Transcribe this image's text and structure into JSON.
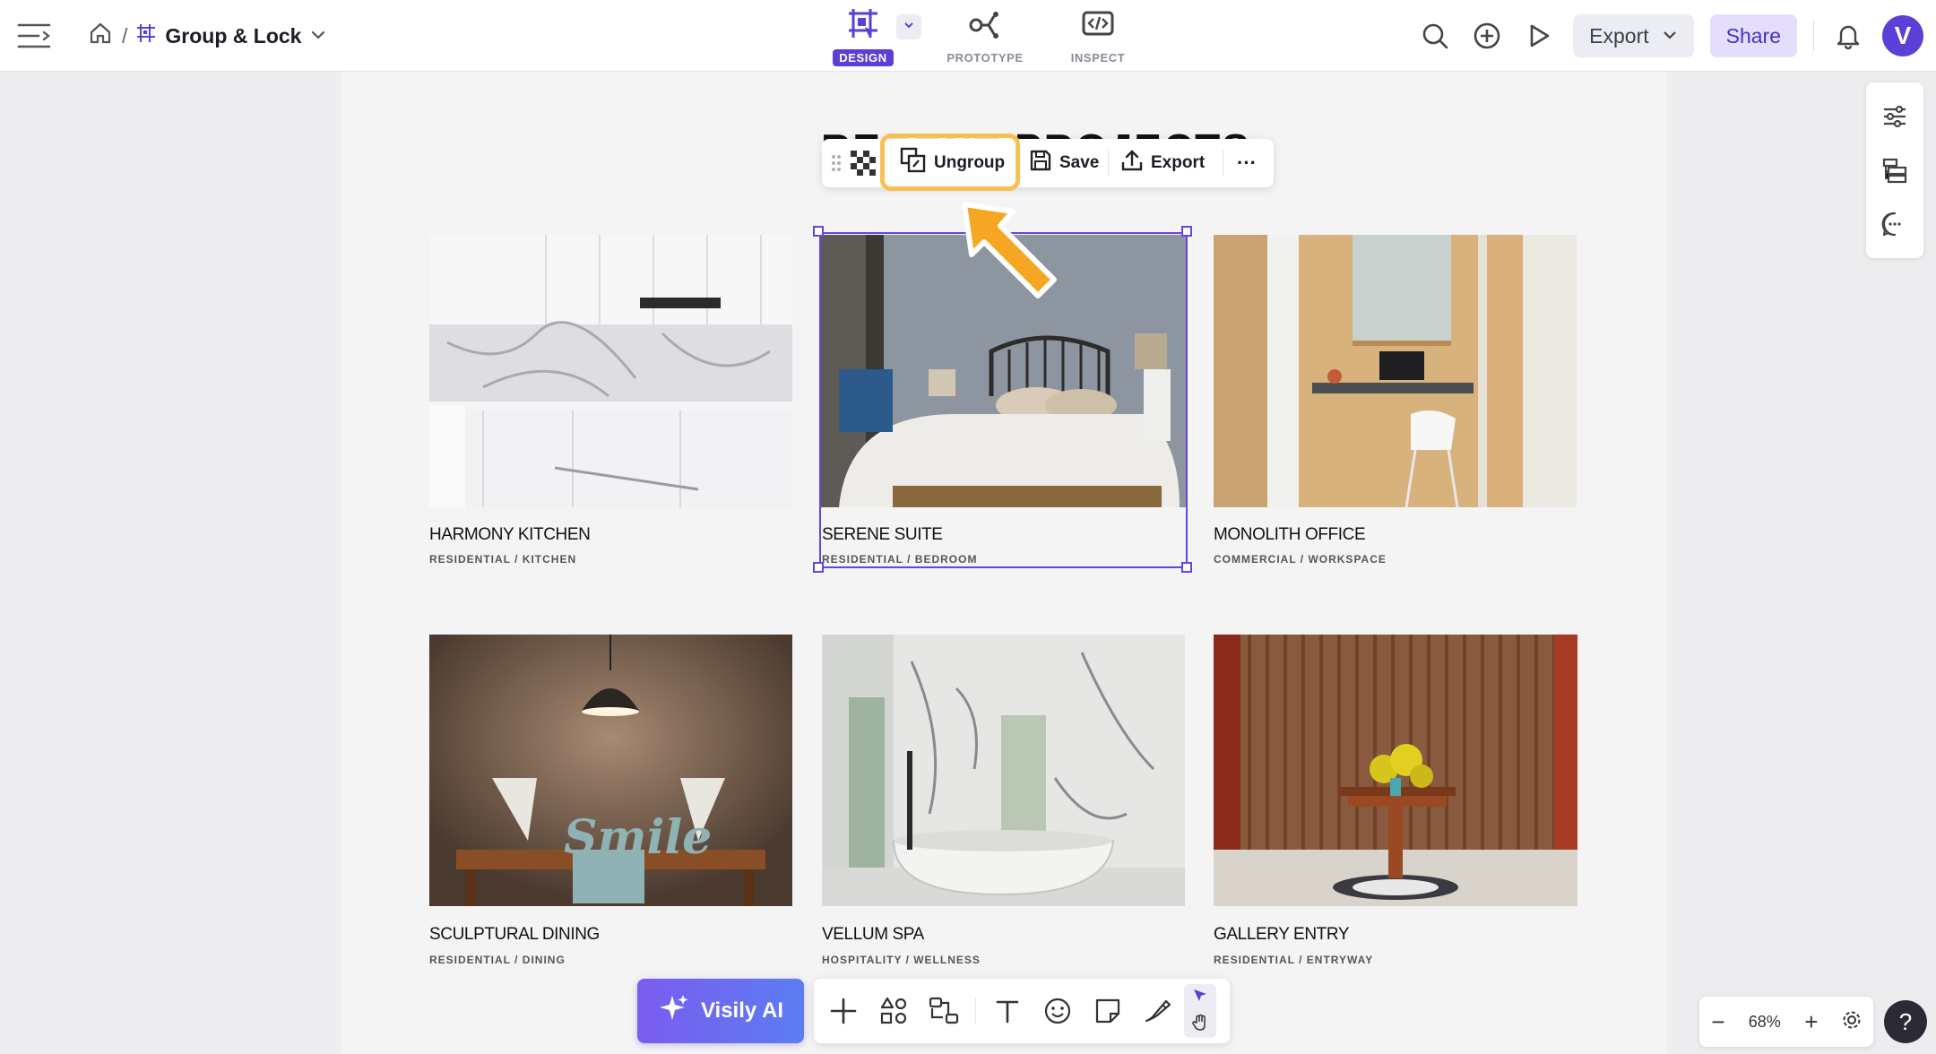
{
  "header": {
    "breadcrumb_separator": "/",
    "file_title": "Group & Lock",
    "modes": [
      {
        "label": "DESIGN",
        "icon": "design-frame-icon",
        "active": true
      },
      {
        "label": "PROTOTYPE",
        "icon": "prototype-flow-icon",
        "active": false
      },
      {
        "label": "INSPECT",
        "icon": "code-inspect-icon",
        "active": false
      }
    ],
    "export_label": "Export",
    "share_label": "Share",
    "avatar_letter": "V"
  },
  "canvas": {
    "heading": "RECENT PROJECTS",
    "projects": [
      {
        "title": "HARMONY KITCHEN",
        "category": "RESIDENTIAL / KITCHEN"
      },
      {
        "title": "SERENE SUITE",
        "category": "RESIDENTIAL / BEDROOM"
      },
      {
        "title": "MONOLITH OFFICE",
        "category": "COMMERCIAL / WORKSPACE"
      },
      {
        "title": "SCULPTURAL DINING",
        "category": "RESIDENTIAL / DINING"
      },
      {
        "title": "VELLUM SPA",
        "category": "HOSPITALITY / WELLNESS"
      },
      {
        "title": "GALLERY ENTRY",
        "category": "RESIDENTIAL / ENTRYWAY"
      }
    ],
    "sign_text": "Smile"
  },
  "floating_toolbar": {
    "ungroup_label": "Ungroup",
    "save_label": "Save",
    "export_label": "Export",
    "more_label": "···"
  },
  "bottom_toolbar": {
    "ai_label": "Visily AI",
    "tools": [
      "add-icon",
      "components-icon",
      "flow-icon",
      "text-icon",
      "emoji-icon",
      "sticky-note-icon",
      "draw-icon"
    ]
  },
  "zoom": {
    "minus": "−",
    "value": "68%",
    "plus": "+"
  },
  "help_label": "?",
  "colors": {
    "accent": "#5b3fd6",
    "highlight": "#f7c052",
    "pointer": "#f5a623"
  }
}
